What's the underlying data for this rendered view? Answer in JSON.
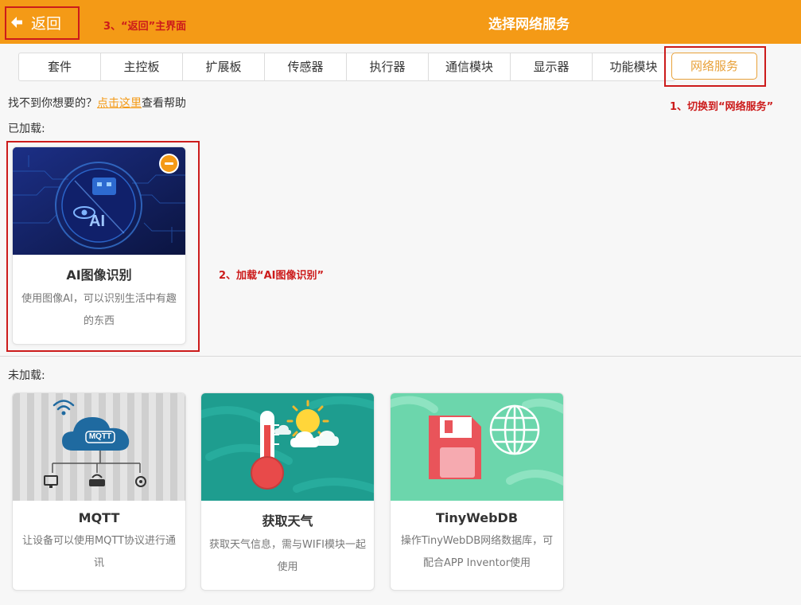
{
  "header": {
    "back_label": "返回",
    "title": "选择网络服务",
    "color": "#f49a16"
  },
  "tabs": [
    "套件",
    "主控板",
    "扩展板",
    "传感器",
    "执行器",
    "通信模块",
    "显示器",
    "功能模块"
  ],
  "active_tab": "网络服务",
  "help": {
    "prefix": "找不到你想要的？",
    "link": "点击这里",
    "suffix": "查看帮助"
  },
  "loaded_label": "已加载:",
  "unloaded_label": "未加载:",
  "loaded": [
    {
      "name": "AI图像识别",
      "desc": "使用图像AI，可以识别生活中有趣的东西",
      "icon": "ai-image-recognition-icon",
      "icon_text": "AI"
    }
  ],
  "unloaded": [
    {
      "name": "MQTT",
      "desc": "让设备可以使用MQTT协议进行通讯",
      "icon": "mqtt-cloud-icon",
      "icon_text": "MQTT"
    },
    {
      "name": "获取天气",
      "desc": "获取天气信息，需与WIFI模块一起使用",
      "icon": "weather-icon"
    },
    {
      "name": "TinyWebDB",
      "desc": "操作TinyWebDB网络数据库，可配合APP Inventor使用",
      "icon": "database-icon"
    }
  ],
  "annotations": {
    "step1": "1、切换到“网络服务”",
    "step2": "2、加载“AI图像识别”",
    "step3": "3、“返回”主界面"
  },
  "colors": {
    "accent": "#f49a16",
    "annotation": "#cc1b1b",
    "active_tab": "#e8a13a"
  }
}
